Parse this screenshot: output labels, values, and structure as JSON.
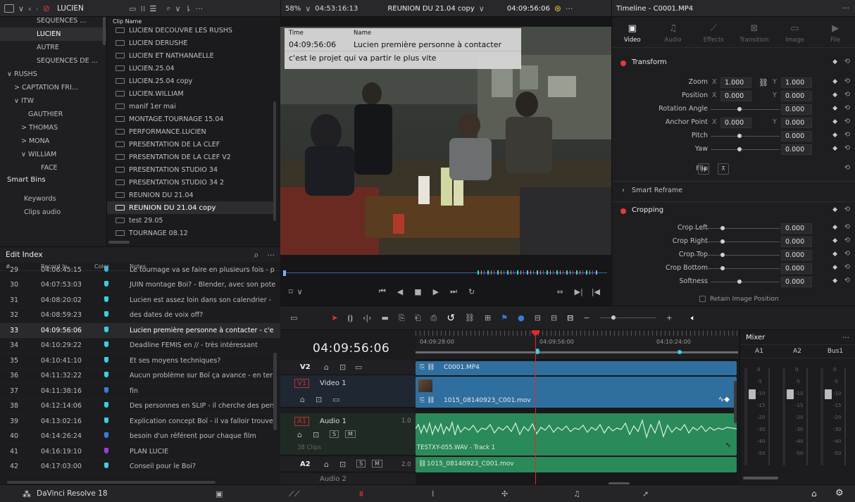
{
  "topbar": {
    "project_bin": "LUCIEN",
    "zoom": "58%",
    "source_tc": "04:53:16:13",
    "timeline_name": "REUNION DU 21.04 copy",
    "record_tc": "04:09:56:06",
    "inspector_title": "Timeline - C0001.MP4"
  },
  "bins": [
    {
      "label": "SEQUENCES ...",
      "indent": 52
    },
    {
      "label": "LUCIEN",
      "indent": 52,
      "sel": true
    },
    {
      "label": "AUTRE",
      "indent": 52
    },
    {
      "label": "SEQUENCES DE ...",
      "indent": 52
    },
    {
      "label": "∨  RUSHS",
      "indent": 10
    },
    {
      "label": ">  CAPTATION FRI...",
      "indent": 20
    },
    {
      "label": "∨  ITW",
      "indent": 20
    },
    {
      "label": "GAUTHIER",
      "indent": 40
    },
    {
      "label": ">  THOMAS",
      "indent": 30
    },
    {
      "label": ">  MONA",
      "indent": 30
    },
    {
      "label": "∨  WILLIAM",
      "indent": 30
    },
    {
      "label": "FACE",
      "indent": 58
    }
  ],
  "smart_bins": {
    "title": "Smart Bins",
    "items": [
      "Keywords",
      "Clips audio"
    ]
  },
  "clips": {
    "header": "Clip Name",
    "items": [
      "LUCIEN DECOUVRE LES RUSHS",
      "LUCIEN DERUSHE",
      "LUCIEN ET NATHANAELLE",
      "LUCIEN.25.04",
      "LUCIEN.25.04 copy",
      "LUCIEN.WILLIAM",
      "manif 1er mai",
      "MONTAGE.TOURNAGE 15.04",
      "PERFORMANCE.LUCIEN",
      "PRESENTATION DE LA CLEF",
      "PRESENTATION DE LA CLEF V2",
      "PRESENTATION STUDIO 34",
      "PRESENTATION STUDIO 34 2",
      "REUNION DU 21.04",
      "REUNION DU 21.04 copy",
      "test 29.05",
      "TOURNAGE 08.12"
    ],
    "selected_index": 14
  },
  "edit_index": {
    "title": "Edit Index",
    "columns": [
      "#",
      "Record In",
      "Color",
      "Notes"
    ],
    "rows": [
      {
        "n": "29",
        "t": "04:06:45:15",
        "c": "#3bb8d8",
        "note": "Le tournage va se faire en plusieurs fois - p"
      },
      {
        "n": "30",
        "t": "04:07:53:03",
        "c": "#3bd0e0",
        "note": "JUIN montage Boi? - Blender, avec son pote"
      },
      {
        "n": "31",
        "t": "04:08:20:02",
        "c": "#3bd0e0",
        "note": "Lucien est assez loin dans son calendrier - "
      },
      {
        "n": "32",
        "t": "04:08:59:23",
        "c": "#3bd0e0",
        "note": "des dates de voix off?"
      },
      {
        "n": "33",
        "t": "04:09:56:06",
        "c": "#3bd0e0",
        "note": "Lucien première personne à contacter - c'e",
        "sel": true
      },
      {
        "n": "34",
        "t": "04:10:29:22",
        "c": "#3bd0e0",
        "note": "Deadline FEMIS en // - très intéressant"
      },
      {
        "n": "35",
        "t": "04:10:41:10",
        "c": "#3bd0e0",
        "note": "Et ses moyens techniques?"
      },
      {
        "n": "36",
        "t": "04:11:32:22",
        "c": "#3bd0e0",
        "note": "Aucun problème sur Boï ça avance - en ter"
      },
      {
        "n": "37",
        "t": "04:11:38:16",
        "c": "#3a7bdc",
        "note": "fin"
      },
      {
        "n": "38",
        "t": "04:12:14:06",
        "c": "#3bd0e0",
        "note": "Des personnes en SLIP - il cherche des pers"
      },
      {
        "n": "39",
        "t": "04:13:02:16",
        "c": "#3bd0e0",
        "note": "Explication concept Boï - il va falloir trouver"
      },
      {
        "n": "40",
        "t": "04:14:26:24",
        "c": "#3a7bdc",
        "note": "besoin d'un référent pour chaque film"
      },
      {
        "n": "41",
        "t": "04:16:19:10",
        "c": "#9b3be0",
        "note": "PLAN LUCIE"
      },
      {
        "n": "42",
        "t": "04:17:03:00",
        "c": "#3bd0e0",
        "note": "Conseil pour le Boi?"
      }
    ]
  },
  "viewer": {
    "marker_time_label": "Time",
    "marker_name_label": "Name",
    "marker_time": "04:09:56:06",
    "marker_name": "Lucien première personne à contacter",
    "marker_note": "c'est le projet qui va partir le plus vite"
  },
  "inspector": {
    "tabs": [
      {
        "label": "Video",
        "active": true
      },
      {
        "label": "Audio"
      },
      {
        "label": "Effects"
      },
      {
        "label": "Transition"
      },
      {
        "label": "Image"
      },
      {
        "label": "File"
      }
    ],
    "transform_title": "Transform",
    "zoom": {
      "label": "Zoom",
      "x": "1.000",
      "y": "1.000"
    },
    "position": {
      "label": "Position",
      "x": "0.000",
      "y": "0.000"
    },
    "rotation": {
      "label": "Rotation Angle",
      "v": "0.000"
    },
    "anchor": {
      "label": "Anchor Point",
      "x": "0.000",
      "y": "0.000"
    },
    "pitch": {
      "label": "Pitch",
      "v": "0.000"
    },
    "yaw": {
      "label": "Yaw",
      "v": "0.000"
    },
    "flip": {
      "label": "Flip"
    },
    "smart_reframe": "Smart Reframe",
    "cropping_title": "Cropping",
    "crop_left": {
      "label": "Crop Left",
      "v": "0.000"
    },
    "crop_right": {
      "label": "Crop Right",
      "v": "0.000"
    },
    "crop_top": {
      "label": "Crop Top",
      "v": "0.000"
    },
    "crop_bottom": {
      "label": "Crop Bottom",
      "v": "0.000"
    },
    "softness": {
      "label": "Softness",
      "v": "0.000"
    },
    "retain": "Retain Image Position",
    "x_label": "X",
    "y_label": "Y"
  },
  "timeline": {
    "timecode": "04:09:56:06",
    "ruler": [
      "04:09:28:00",
      "04:09:56:00",
      "04:10:24:00"
    ],
    "v2": {
      "name": "V2",
      "clip": "C0001.MP4"
    },
    "v1": {
      "name": "V1",
      "label": "Video 1",
      "clip": "1015_08140923_C001.mov"
    },
    "a1": {
      "name": "A1",
      "label": "Audio 1",
      "gain": "1.0",
      "clips": "38 Clips",
      "clip": "TESTXY-055.WAV - Track 1"
    },
    "a2": {
      "name": "A2",
      "gain": "2.0",
      "clip": "1015_08140923_C001.mov",
      "label": "Audio 2"
    },
    "mixer": {
      "title": "Mixer",
      "channels": [
        "A1",
        "A2",
        "Bus1"
      ],
      "scale": [
        "0",
        "-5",
        "-10",
        "-15",
        "-20",
        "-30",
        "-40",
        "-50"
      ]
    }
  },
  "bottom": {
    "app": "DaVinci Resolve 18"
  },
  "colors": {
    "accent": "#e23b3b",
    "timecode": "#e8e8e8",
    "video_clip": "#2f6f9f",
    "audio_clip": "#2a8a5a",
    "playhead": "#e02b2b"
  }
}
